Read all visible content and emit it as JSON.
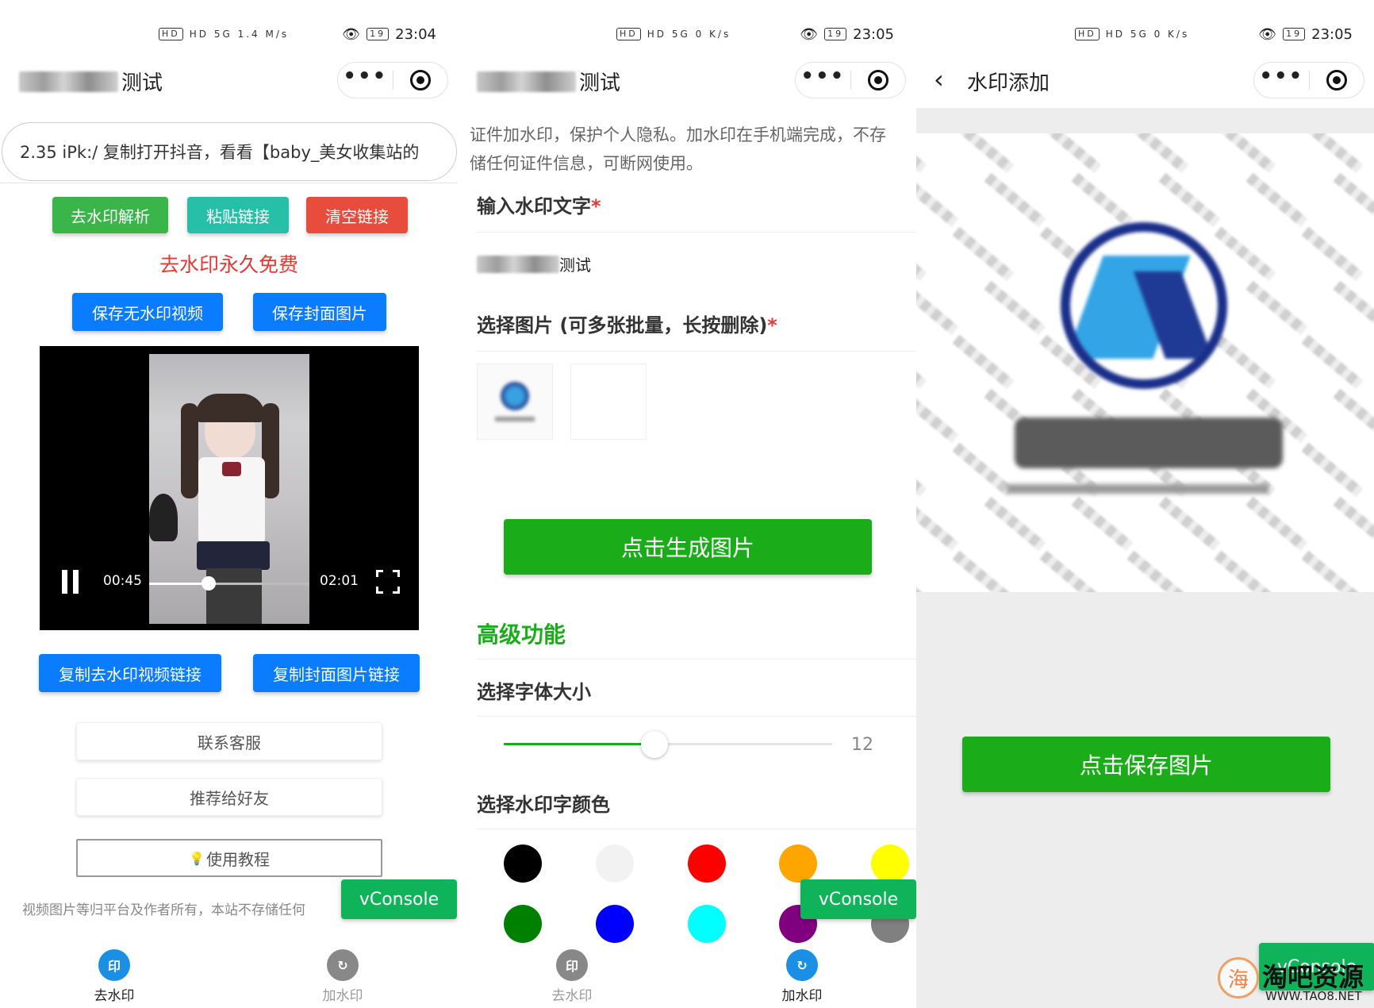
{
  "panel1": {
    "status": {
      "icons": "HD 5G 1.4 M/s",
      "time": "23:04",
      "battery": "19"
    },
    "nav": {
      "title_suffix": "测试"
    },
    "link_input": {
      "value": "2.35 iPk:/ 复制打开抖音，看看【baby_美女收集站的"
    },
    "buttons": {
      "parse": "去水印解析",
      "paste": "粘贴链接",
      "clear": "清空链接"
    },
    "free_banner": "去水印永久免费",
    "save_buttons": {
      "video": "保存无水印视频",
      "cover": "保存封面图片"
    },
    "player": {
      "current": "00:45",
      "duration": "02:01",
      "progress": 0.37
    },
    "copy_buttons": {
      "video": "复制去水印视频链接",
      "cover": "复制封面图片链接"
    },
    "contact": "联系客服",
    "recommend": "推荐给好友",
    "tutorial": "使用教程",
    "disclaimer": "视频图片等归平台及作者所有，本站不存储任何",
    "vconsole": "vConsole",
    "tabs": [
      {
        "label": "去水印",
        "icon": "印"
      },
      {
        "label": "加水印",
        "icon": "↻"
      }
    ]
  },
  "panel2": {
    "status": {
      "icons": "HD 5G 0 K/s",
      "time": "23:05",
      "battery": "19"
    },
    "nav": {
      "title_suffix": "测试"
    },
    "intro": "证件加水印，保护个人隐私。加水印在手机端完成，不存储任何证件信息，可断网使用。",
    "text_label": "输入水印文字",
    "text_value": "测试",
    "image_label": "选择图片 (可多张批量，长按删除)",
    "generate": "点击生成图片",
    "advanced": "高级功能",
    "font_size_label": "选择字体大小",
    "font_size": 12,
    "font_size_progress": 0.46,
    "color_label": "选择水印字颜色",
    "colors": [
      "#000000",
      "#f2f2f2",
      "#ff0000",
      "#ffa500",
      "#ffff00",
      "#008000",
      "#0000ff",
      "#00ffff",
      "#800080",
      "#808080"
    ],
    "vconsole": "vConsole",
    "tabs": [
      {
        "label": "去水印",
        "icon": "印"
      },
      {
        "label": "加水印",
        "icon": "↻"
      }
    ]
  },
  "panel3": {
    "status": {
      "icons": "HD 5G 0 K/s",
      "time": "23:05",
      "battery": "19"
    },
    "nav": {
      "title": "水印添加"
    },
    "save": "点击保存图片",
    "vconsole": "vConsole",
    "watermark_brand": "淘吧资源",
    "watermark_url": "WWW.TAO8.NET"
  },
  "icons": {
    "more": "more-dots-icon",
    "close": "record-circle-icon",
    "back": "chevron-left-icon",
    "pause": "pause-icon",
    "fullscreen": "fullscreen-icon"
  }
}
